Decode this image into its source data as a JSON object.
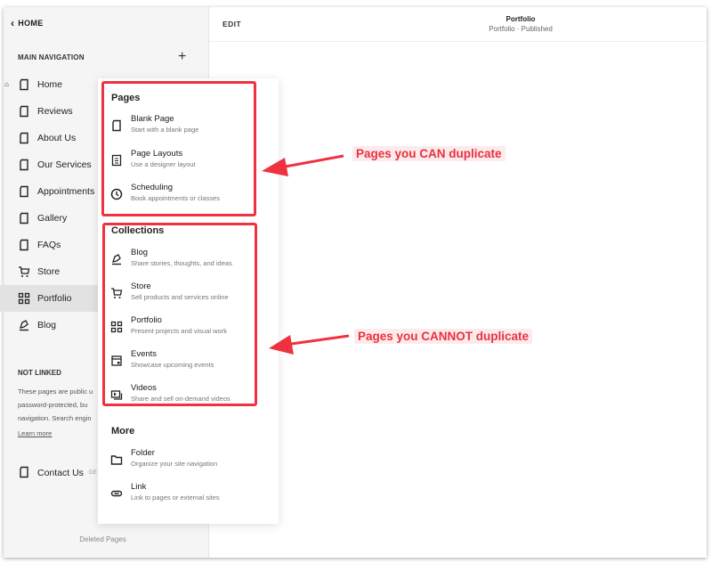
{
  "sidebar": {
    "back_label": "HOME",
    "main_nav_header": "MAIN NAVIGATION",
    "add_icon": "plus-icon",
    "items": [
      {
        "label": "Home",
        "icon": "page-icon",
        "is_homepage": true
      },
      {
        "label": "Reviews",
        "icon": "page-icon"
      },
      {
        "label": "About Us",
        "icon": "page-icon"
      },
      {
        "label": "Our Services",
        "icon": "page-icon"
      },
      {
        "label": "Appointments",
        "icon": "page-icon"
      },
      {
        "label": "Gallery",
        "icon": "page-icon"
      },
      {
        "label": "FAQs",
        "icon": "page-icon"
      },
      {
        "label": "Store",
        "icon": "cart-icon"
      },
      {
        "label": "Portfolio",
        "icon": "grid-icon",
        "active": true
      },
      {
        "label": "Blog",
        "icon": "pen-icon"
      }
    ],
    "not_linked_header": "NOT LINKED",
    "not_linked_lines": [
      "These pages are public u",
      "password-protected, bu",
      "navigation. Search engin"
    ],
    "learn_more": "Learn more",
    "contact_label": "Contact Us",
    "contact_badge": "DE",
    "deleted_pages": "Deleted Pages"
  },
  "topbar": {
    "edit_label": "EDIT",
    "page_title": "Portfolio",
    "page_status": "Portfolio · Published"
  },
  "menu": {
    "pages_header": "Pages",
    "pages": [
      {
        "title": "Blank Page",
        "desc": "Start with a blank page",
        "icon": "page-icon"
      },
      {
        "title": "Page Layouts",
        "desc": "Use a designer layout",
        "icon": "layout-icon"
      },
      {
        "title": "Scheduling",
        "desc": "Book appointments or classes",
        "icon": "clock-icon"
      }
    ],
    "collections_header": "Collections",
    "collections": [
      {
        "title": "Blog",
        "desc": "Share stories, thoughts, and ideas",
        "icon": "pen-icon"
      },
      {
        "title": "Store",
        "desc": "Sell products and services online",
        "icon": "cart-icon"
      },
      {
        "title": "Portfolio",
        "desc": "Present projects and visual work",
        "icon": "grid-icon"
      },
      {
        "title": "Events",
        "desc": "Showcase upcoming events",
        "icon": "calendar-icon"
      },
      {
        "title": "Videos",
        "desc": "Share and sell on-demand videos",
        "icon": "video-icon"
      }
    ],
    "more_header": "More",
    "more": [
      {
        "title": "Folder",
        "desc": "Organize your site navigation",
        "icon": "folder-icon"
      },
      {
        "title": "Link",
        "desc": "Link to pages or external sites",
        "icon": "link-icon"
      }
    ]
  },
  "annotations": {
    "can_label": "Pages you CAN duplicate",
    "cannot_label": "Pages you CANNOT duplicate",
    "color": "#f0313f"
  }
}
